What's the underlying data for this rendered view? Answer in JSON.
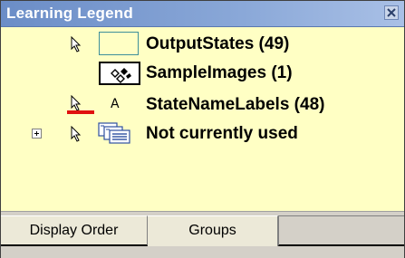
{
  "window": {
    "title": "Learning Legend",
    "close_icon": "close-icon",
    "colors": {
      "titlebar": "#7b9ad0",
      "panel_background": "#ffffc4",
      "state_swatch_border": "#3d8f9a",
      "label_marker": "#e01010"
    }
  },
  "legend": {
    "items": [
      {
        "label": "OutputStates (49)",
        "icon": "output-states-swatch"
      },
      {
        "label": "SampleImages (1)",
        "icon": "sample-images-swatch"
      },
      {
        "label": "StateNameLabels (48)",
        "icon": "text-label-glyph",
        "glyph": "A"
      },
      {
        "label": "Not currently used",
        "icon": "layers-icon",
        "expandable": true
      }
    ]
  },
  "tabs": [
    {
      "label": "Display Order",
      "selected": false
    },
    {
      "label": "Groups",
      "selected": true
    }
  ]
}
